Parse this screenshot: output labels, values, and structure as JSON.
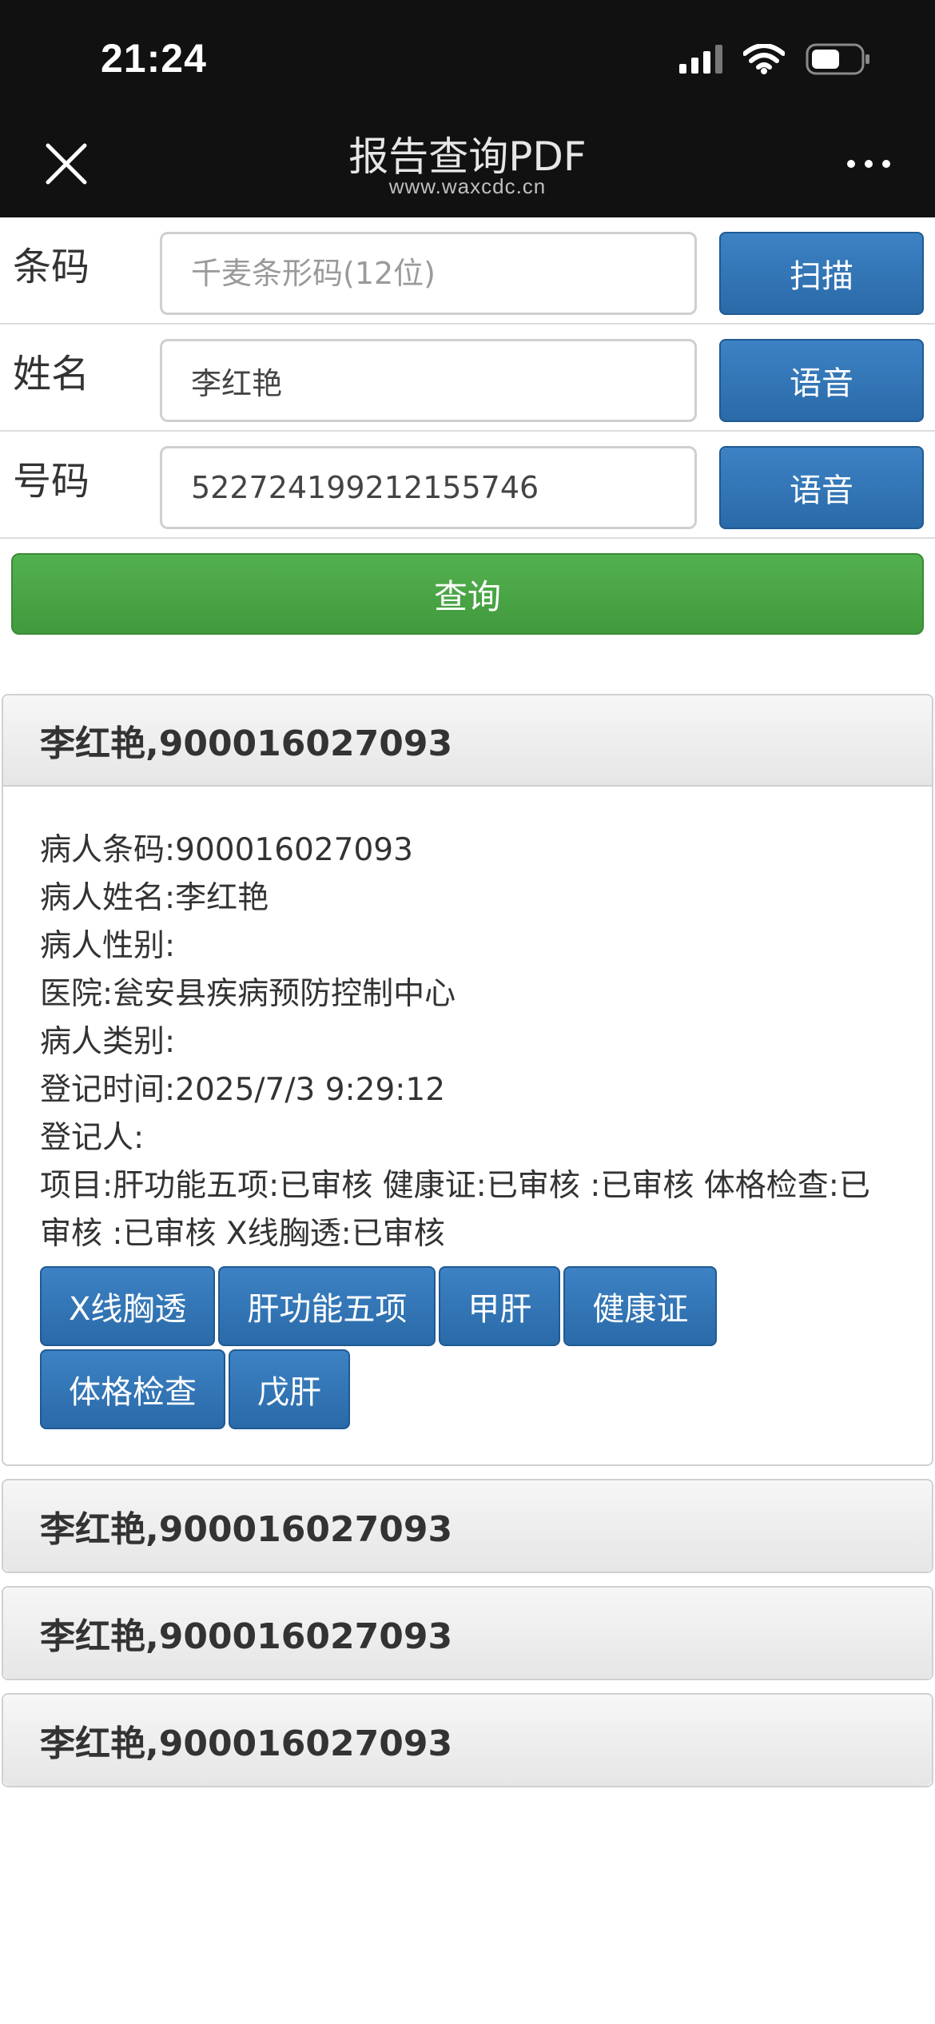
{
  "status_bar": {
    "time": "21:24"
  },
  "nav": {
    "title": "报告查询PDF",
    "subtitle": "www.waxcdc.cn"
  },
  "form": {
    "barcode": {
      "label": "条码",
      "placeholder": "千麦条形码(12位)",
      "value": "",
      "button": "扫描"
    },
    "name": {
      "label": "姓名",
      "value": "李红艳",
      "button": "语音"
    },
    "number": {
      "label": "号码",
      "value": "522724199212155746",
      "button": "语音"
    },
    "query_button": "查询"
  },
  "results": [
    {
      "title": "李红艳,900016027093",
      "details": [
        "病人条码:900016027093",
        "病人姓名:李红艳",
        "病人性别:",
        "医院:瓮安县疾病预防控制中心",
        "病人类别:",
        "登记时间:2025/7/3 9:29:12",
        "登记人:",
        "项目:肝功能五项:已审核 健康证:已审核 :已审核 体格检查:已审核 :已审核 X线胸透:已审核"
      ],
      "buttons": [
        "X线胸透",
        "肝功能五项",
        "甲肝",
        "健康证",
        "体格检查",
        "戊肝"
      ]
    },
    {
      "title": "李红艳,900016027093"
    },
    {
      "title": "李红艳,900016027093"
    },
    {
      "title": "李红艳,900016027093"
    }
  ]
}
